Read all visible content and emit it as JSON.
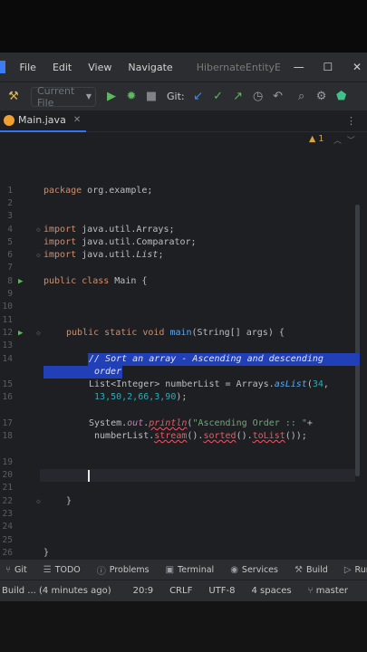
{
  "menu": {
    "items": [
      "File",
      "Edit",
      "View",
      "Navigate"
    ],
    "project_title": "HibernateEntityExamp",
    "window_controls": [
      "—",
      "☐",
      "✕"
    ]
  },
  "toolbar": {
    "run_config": "Current File",
    "git_label": "Git:"
  },
  "tab": {
    "filename": "Main.java"
  },
  "editor": {
    "warning_count": "1",
    "lines": [
      {
        "n": "1"
      },
      {
        "n": "2"
      },
      {
        "n": "3"
      },
      {
        "n": "4"
      },
      {
        "n": "5"
      },
      {
        "n": "6"
      },
      {
        "n": "7"
      },
      {
        "n": "8"
      },
      {
        "n": "9"
      },
      {
        "n": "10"
      },
      {
        "n": "11"
      },
      {
        "n": "12"
      },
      {
        "n": "13"
      },
      {
        "n": "14"
      },
      {
        "n": "15"
      },
      {
        "n": "16"
      },
      {
        "n": "17"
      },
      {
        "n": "18"
      },
      {
        "n": "19"
      },
      {
        "n": "20"
      },
      {
        "n": "21"
      },
      {
        "n": "22"
      },
      {
        "n": "23"
      },
      {
        "n": "24"
      },
      {
        "n": "25"
      },
      {
        "n": "26"
      }
    ],
    "code": {
      "l1_kw": "package",
      "l1_rest": " org.example;",
      "l4_kw": "import",
      "l4_rest": " java.util.Arrays;",
      "l5_kw": "import",
      "l5_rest": " java.util.Comparator;",
      "l6_kw": "import",
      "l6_rest": " java.util.",
      "l6_list": "List",
      "l6_end": ";",
      "l8_kw1": "public",
      "l8_kw2": "class",
      "l8_cls": " Main {",
      "l12_kw1": "public",
      "l12_kw2": "static",
      "l12_kw3": "void",
      "l12_fn": "main",
      "l12_rest": "(String[] args) {",
      "l14_comment": "// Sort an array - Ascending and descending",
      "l14_cont": "order",
      "l16_a": "List<Integer> numberList = Arrays.",
      "l16_m": "asList",
      "l16_n1": "34",
      "l16_cont_pre": " ",
      "l16_nums": "13,50,2,66,3,90",
      "l16_cont_end": ");",
      "l18_a": "System.",
      "l18_out": "out",
      "l18_dot": ".",
      "l18_println": "println",
      "l18_paren": "(",
      "l18_str": "\"Ascending Order :: \"",
      "l18_plus": "+",
      "l18_cont_a": " numberList.",
      "l18_stream": "stream",
      "l18_b": "().",
      "l18_sorted": "sorted",
      "l18_c": "().",
      "l18_tolist": "toList",
      "l18_end": "());",
      "l22": "}",
      "l26": "}"
    }
  },
  "tool_windows": [
    {
      "icon": "git-icon",
      "label": "Git"
    },
    {
      "icon": "todo-icon",
      "label": "TODO"
    },
    {
      "icon": "problems-icon",
      "label": "Problems"
    },
    {
      "icon": "terminal-icon",
      "label": "Terminal"
    },
    {
      "icon": "services-icon",
      "label": "Services"
    },
    {
      "icon": "build-icon",
      "label": "Build"
    },
    {
      "icon": "run-icon",
      "label": "Run"
    }
  ],
  "status": {
    "build_msg": "Build ... (4 minutes ago)",
    "position": "20:9",
    "line_sep": "CRLF",
    "encoding": "UTF-8",
    "indent": "4 spaces",
    "branch": "master"
  }
}
